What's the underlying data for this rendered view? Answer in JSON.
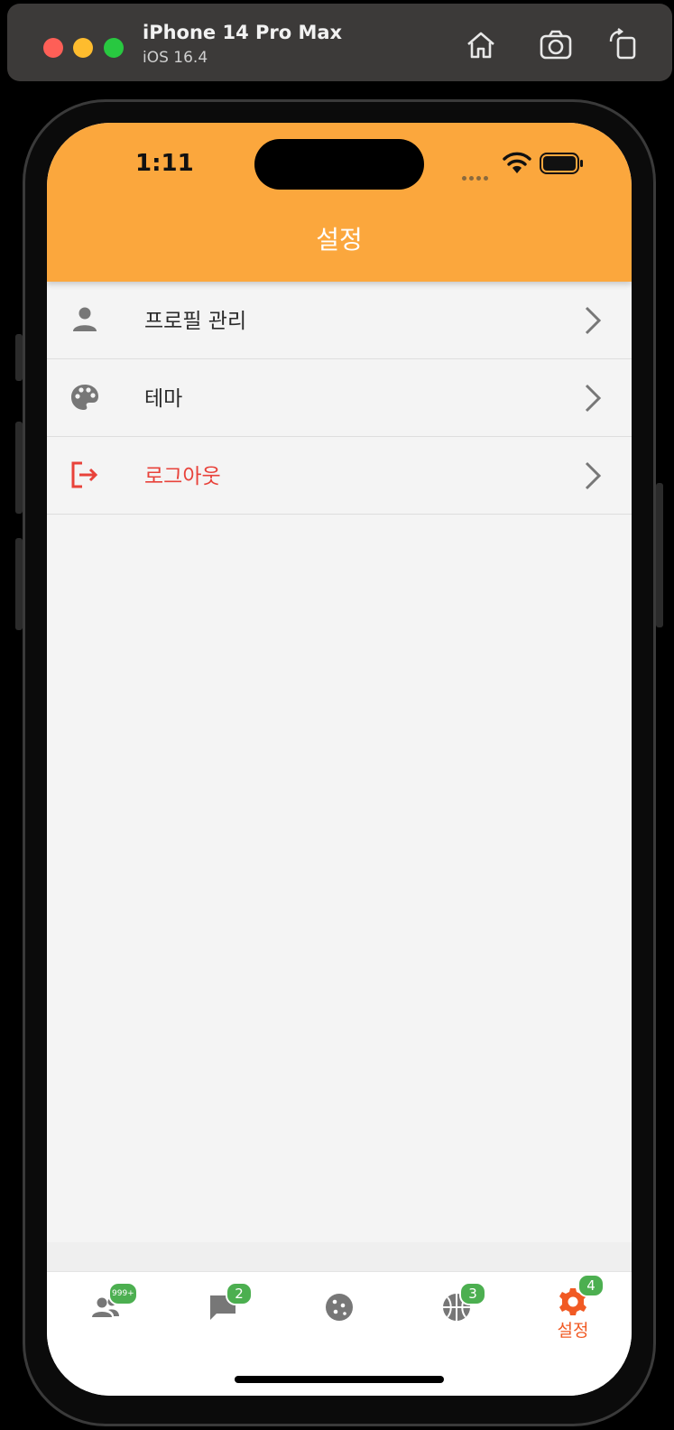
{
  "simulator": {
    "device_name": "iPhone 14 Pro Max",
    "os_version": "iOS 16.4",
    "buttons": [
      "home-icon",
      "screenshot-icon",
      "rotate-icon"
    ]
  },
  "status_bar": {
    "time": "1:11"
  },
  "header": {
    "title": "설정",
    "color": "#fba73d"
  },
  "menu": {
    "items": [
      {
        "label": "프로필 관리",
        "icon": "person-icon"
      },
      {
        "label": "테마",
        "icon": "palette-icon"
      },
      {
        "label": "로그아웃",
        "icon": "logout-icon",
        "color": "#e8423a"
      }
    ]
  },
  "tabbar": {
    "tabs": [
      {
        "icon": "people-icon",
        "badge": "999+"
      },
      {
        "icon": "chat-icon",
        "badge": "2"
      },
      {
        "icon": "cookie-icon",
        "badge": ""
      },
      {
        "icon": "basketball-icon",
        "badge": "3"
      },
      {
        "icon": "gear-icon",
        "badge": "4",
        "label": "설정",
        "active": true
      }
    ],
    "active_color": "#f15a24",
    "badge_color": "#4caf50"
  }
}
